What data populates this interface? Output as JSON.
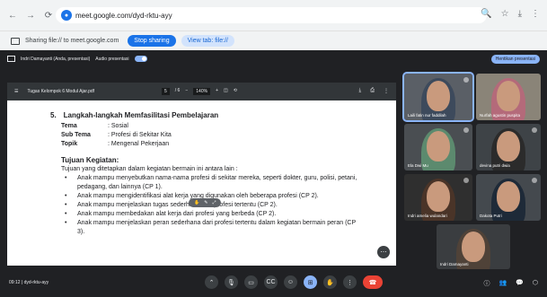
{
  "browser": {
    "url": "meet.google.com/dyd-rktu-ayy",
    "back": "←",
    "forward": "→",
    "reload": "⟳",
    "zoom_icon": "🔍",
    "star_icon": "☆",
    "download_icon": "⤓",
    "menu_icon": "⋮"
  },
  "share_bar": {
    "text": "Sharing file:// to meet.google.com",
    "stop_label": "Stop sharing",
    "view_label": "View tab: file://"
  },
  "meet": {
    "presenter": "Indri Damayanti (Anda, presentasi)",
    "audio_label": "Audio presentasi",
    "stop_presenting": "Hentikan presentasi",
    "time": "09:12",
    "meeting_code": "dyd-rktu-ayy"
  },
  "pdf": {
    "title": "Tugas Kelompok 6 Modul Ajar.pdf",
    "page": "5",
    "page_total": "/ 6",
    "zoom": "140%",
    "section_num": "5.",
    "section_title": "Langkah-langkah Memfasilitasi Pembelajaran",
    "meta": [
      {
        "k": "Tema",
        "v": ": Sosial"
      },
      {
        "k": "Sub Tema",
        "v": ": Profesi di Sekitar Kita"
      },
      {
        "k": "Topik",
        "v": ": Mengenal Pekerjaan"
      }
    ],
    "tujuan_title": "Tujuan Kegiatan:",
    "tujuan_intro": "Tujuan yang ditetapkan dalam kegiatan bermain ini antara lain :",
    "bullets": [
      "Anak mampu menyebutkan nama-nama profesi di sekitar mereka, seperti dokter, guru, polisi, petani, pedagang, dan lainnya (CP 1).",
      "Anak mampu mengidentifikasi alat kerja yang digunakan oleh beberapa profesi (CP 2).",
      "Anak mampu menjelaskan tugas sederhana dari profesi tertentu  (CP 2).",
      "Anak mampu membedakan alat kerja dari profesi yang berbeda (CP 2).",
      "Anak mampu menjelaskan peran sederhana dari profesi tertentu dalam kegiatan bermain peran (CP 3)."
    ]
  },
  "participants": [
    {
      "name": "Laili fatin nur faddilah",
      "hijab": "#3d4a5c",
      "bg": "#5a5f66"
    },
    {
      "name": "Nurfah agustin puspita",
      "hijab": "#b46a7a",
      "bg": "#8a8478"
    },
    {
      "name": "Ela Dwi Mu",
      "hijab": "#5c8a6e",
      "bg": "#4a4e52"
    },
    {
      "name": "devina putri dwia",
      "hijab": "#2b2b2b",
      "bg": "#3e4347"
    },
    {
      "name": "Indri amelia wulandari",
      "hijab": "#4a3428",
      "bg": "#2f2f2f"
    },
    {
      "name": "Dakota Putri",
      "hijab": "#1e2a38",
      "bg": "#44494e"
    },
    {
      "name": "Indri Damayanti",
      "hijab": "#4f4238",
      "bg": "#3a3d40"
    }
  ]
}
